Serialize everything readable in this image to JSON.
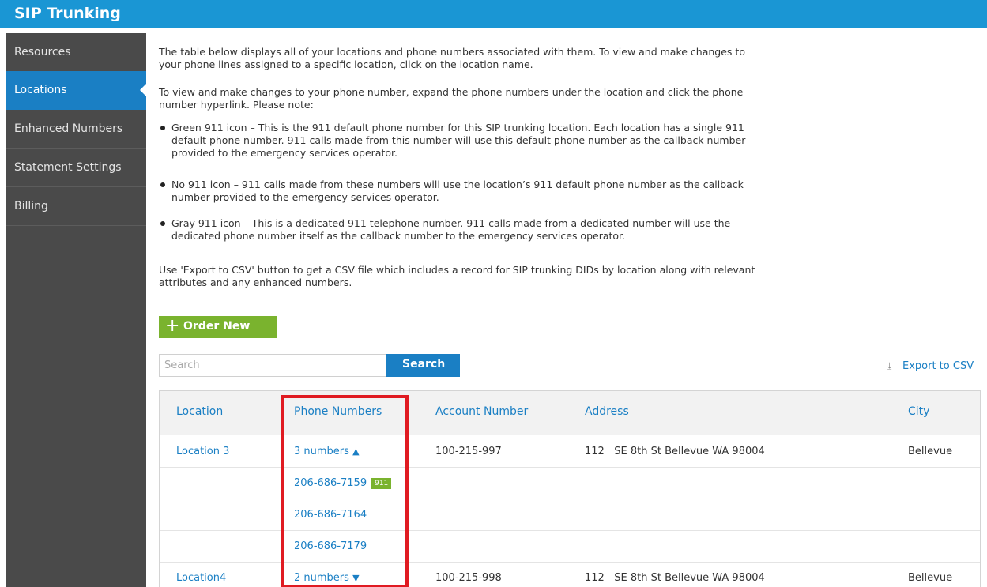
{
  "app": {
    "title": "SIP Trunking"
  },
  "sidebar": {
    "items": [
      {
        "label": "Resources",
        "active": false
      },
      {
        "label": "Locations",
        "active": true
      },
      {
        "label": "Enhanced Numbers",
        "active": false
      },
      {
        "label": "Statement Settings",
        "active": false
      },
      {
        "label": "Billing",
        "active": false
      }
    ]
  },
  "intro": {
    "p1": "The table below displays all of your locations and phone numbers associated with them. To view and make changes to your phone lines assigned to a specific location, click on the location name.",
    "p2": "To view and make changes to your phone number, expand the phone numbers under the location and click the phone number hyperlink. Please note:",
    "bullets": [
      "Green 911 icon – This is the 911 default phone number for this SIP trunking location. Each location has a single 911 default phone number. 911 calls made from this number will use this default phone number as the callback number provided to the emergency services operator.",
      "No 911 icon – 911 calls made from these numbers will use the location’s 911 default phone number as the callback number provided to the emergency services operator.",
      "Gray 911 icon – This is a dedicated 911 telephone number. 911 calls made from a dedicated number will use the dedicated phone number itself as the callback number to the emergency services operator."
    ],
    "p3": "Use 'Export to CSV' button to get a CSV file which includes a record for SIP trunking DIDs by location along with relevant attributes and any enhanced numbers."
  },
  "toolbar": {
    "order_new_label": "Order New",
    "search_placeholder": "Search",
    "search_button_label": "Search",
    "export_label": "Export to CSV"
  },
  "table": {
    "headers": {
      "location": "Location",
      "phone_numbers": "Phone Numbers",
      "account_number": "Account Number",
      "address": "Address",
      "city": "City"
    },
    "rows": [
      {
        "location": "Location 3",
        "phone": "3 numbers",
        "chevron": "up",
        "account": "100-215-997",
        "address_num": "112",
        "address_street": "SE 8th St",
        "address_rest": "Bellevue WA 98004",
        "city": "Bellevue"
      },
      {
        "phone": "206-686-7159",
        "badge": "911"
      },
      {
        "phone": "206-686-7164"
      },
      {
        "phone": "206-686-7179"
      },
      {
        "location": "Location4",
        "phone": "2 numbers",
        "chevron": "down",
        "account": "100-215-998",
        "address_num": "112",
        "address_street": "SE 8th St",
        "address_rest": "Bellevue WA 98004",
        "city": "Bellevue"
      }
    ]
  },
  "colors": {
    "header_blue": "#1a96d4",
    "active_blue": "#1a7fc4",
    "sidebar_gray": "#4a4a4a",
    "green": "#7ab32e",
    "highlight_red": "#e01b22"
  },
  "icons": [
    "plus-icon",
    "download-icon",
    "chevron-up-icon",
    "chevron-down-icon",
    "nav-caret-icon"
  ]
}
